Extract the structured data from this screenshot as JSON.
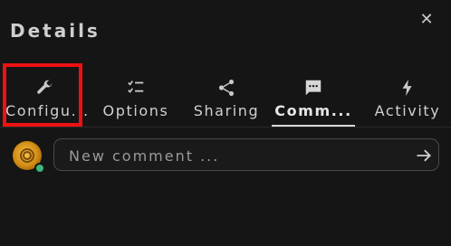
{
  "panel": {
    "title": "Details",
    "close_icon": "close-icon"
  },
  "tabs": [
    {
      "label": "Configu...",
      "icon": "wrench-icon",
      "active": false
    },
    {
      "label": "Options",
      "icon": "checklist-icon",
      "active": false
    },
    {
      "label": "Sharing",
      "icon": "share-icon",
      "active": false
    },
    {
      "label": "Comm...",
      "icon": "comment-icon",
      "active": true
    },
    {
      "label": "Activity",
      "icon": "lightning-icon",
      "active": false
    }
  ],
  "comment": {
    "placeholder": "New comment ...",
    "value": "",
    "send_icon": "send-arrow-icon",
    "avatar_status_color": "#3fb67b"
  },
  "highlight_color": "#ee1111"
}
